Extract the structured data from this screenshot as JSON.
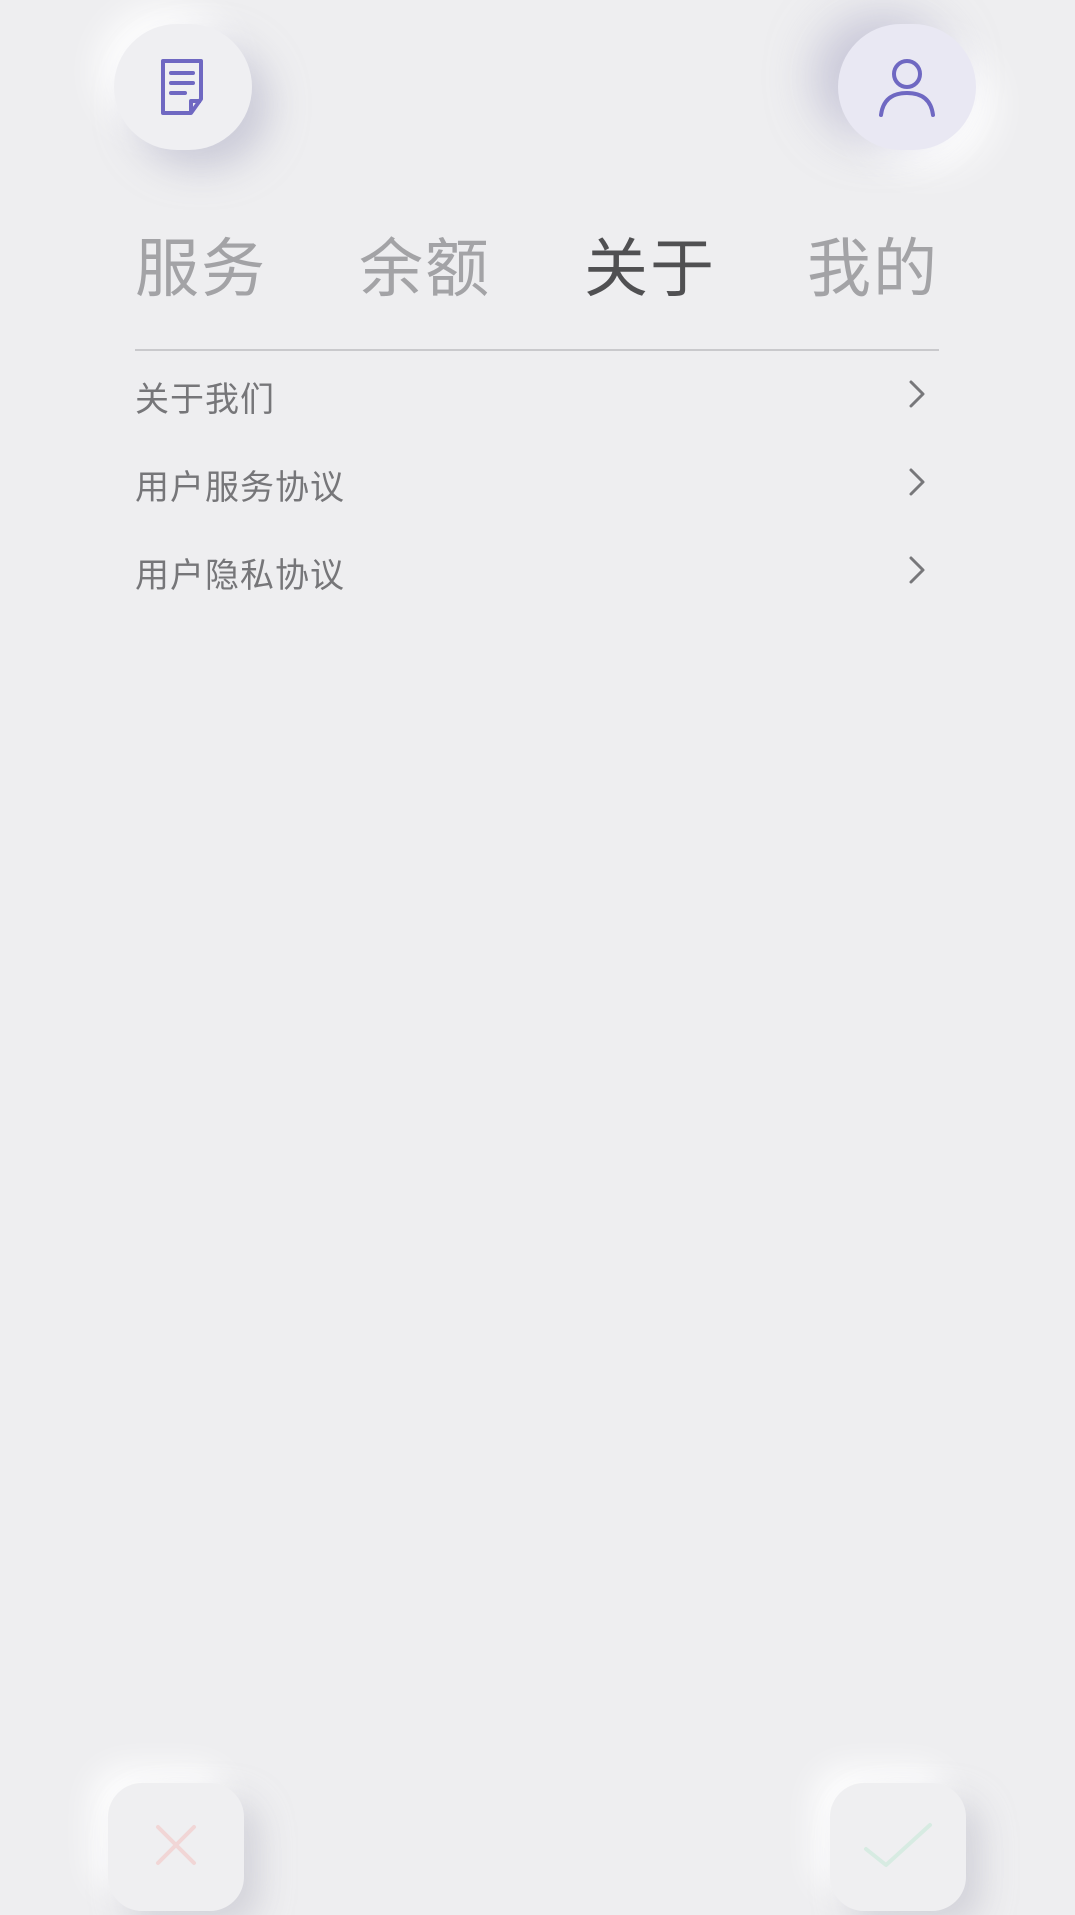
{
  "header": {
    "left_button_icon": "document-icon",
    "right_button_icon": "user-icon",
    "accent_color": "#6f68c2"
  },
  "tabs": [
    {
      "label": "服务",
      "active": false
    },
    {
      "label": "余额",
      "active": false
    },
    {
      "label": "关于",
      "active": true
    },
    {
      "label": "我的",
      "active": false
    }
  ],
  "menu": {
    "items": [
      {
        "label": "关于我们",
        "icon": "chevron-right-icon"
      },
      {
        "label": "用户服务协议",
        "icon": "chevron-right-icon"
      },
      {
        "label": "用户隐私协议",
        "icon": "chevron-right-icon"
      }
    ]
  },
  "footer": {
    "cancel_icon": "close-icon",
    "cancel_color": "#f1d6d6",
    "confirm_icon": "check-icon",
    "confirm_color": "#d7ebe2"
  }
}
